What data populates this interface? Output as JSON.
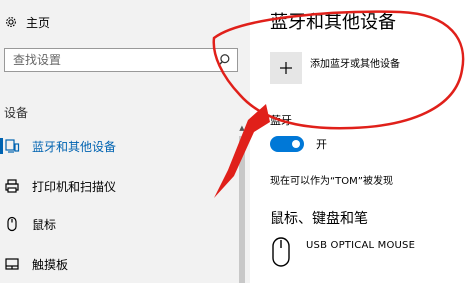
{
  "sidebar": {
    "home_label": "主页",
    "search": {
      "placeholder": "查找设置"
    },
    "section_label": "设备",
    "items": [
      {
        "label": "蓝牙和其他设备",
        "icon": "bluetooth-devices-icon",
        "active": true
      },
      {
        "label": "打印机和扫描仪",
        "icon": "printer-icon",
        "active": false
      },
      {
        "label": "鼠标",
        "icon": "mouse-icon",
        "active": false
      },
      {
        "label": "触摸板",
        "icon": "touchpad-icon",
        "active": false
      }
    ]
  },
  "main": {
    "title": "蓝牙和其他设备",
    "add_device_label": "添加蓝牙或其他设备",
    "bluetooth_label": "蓝牙",
    "bluetooth_state": "开",
    "discoverable_text": "现在可以作为“TOM”被发现",
    "section_title": "鼠标、键盘和笔",
    "device_name": "USB OPTICAL MOUSE"
  },
  "colors": {
    "accent": "#0078d7",
    "active_nav": "#0063b1",
    "annotation": "#e0201a"
  }
}
